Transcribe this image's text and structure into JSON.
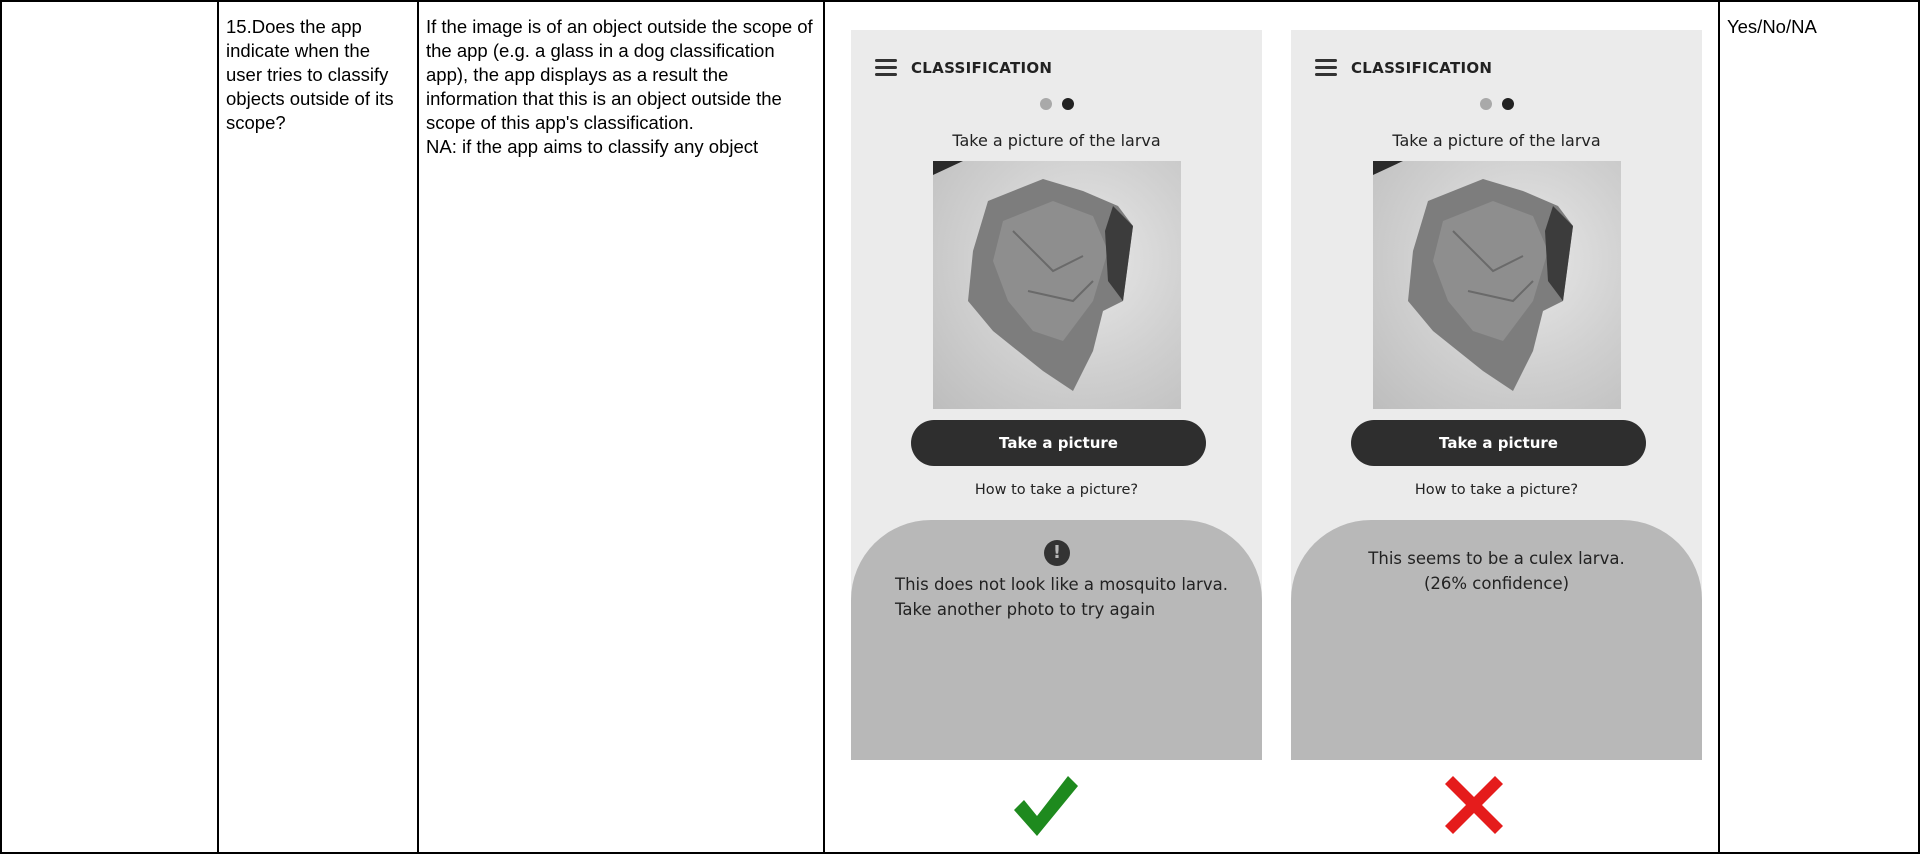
{
  "row": {
    "question": "15.Does the app indicate when the user tries to classify objects outside of its scope?",
    "criterion_line1": "If the image is of an object outside the scope of the app (e.g. a glass in a dog classification app), the app displays as a result the information that this is an object outside the scope of this app's classification.",
    "criterion_line2": "NA: if the app aims to classify any object",
    "answer_options": "Yes/No/NA"
  },
  "phones": [
    {
      "title": "CLASSIFICATION",
      "caption": "Take a picture of the larva",
      "button": "Take a picture",
      "howto": "How to take a picture?",
      "message_line1": "This does not look like a mosquito larva.",
      "message_line2": "Take another photo to try again",
      "icon": "exclamation-icon",
      "verdict": "check-mark-icon",
      "verdict_color": "#1e8a1e"
    },
    {
      "title": "CLASSIFICATION",
      "caption": "Take a picture of the larva",
      "button": "Take a picture",
      "howto": "How to take a picture?",
      "message_line1": "This seems to be a culex larva.",
      "message_line2": "(26% confidence)",
      "verdict": "cross-mark-icon",
      "verdict_color": "#e51c1c"
    }
  ]
}
